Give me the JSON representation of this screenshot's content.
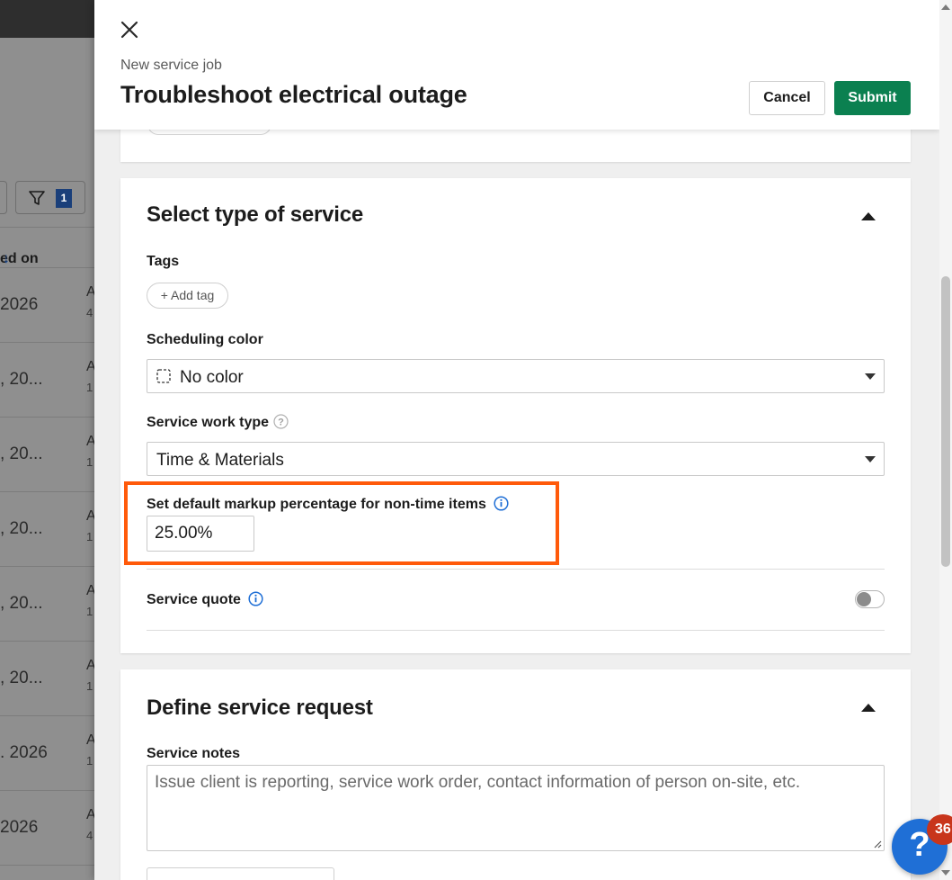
{
  "background": {
    "filter_count": "1",
    "column_header": "ed on",
    "rows": [
      {
        "date": "2026",
        "a": "A",
        "b": "4"
      },
      {
        "date": ", 20...",
        "a": "A",
        "b": "1"
      },
      {
        "date": ", 20...",
        "a": "A",
        "b": "1"
      },
      {
        "date": ", 20...",
        "a": "A",
        "b": "1"
      },
      {
        "date": ", 20...",
        "a": "A",
        "b": "1"
      },
      {
        "date": ", 20...",
        "a": "A",
        "b": "1"
      },
      {
        "date": ". 2026",
        "a": "A",
        "b": "1"
      },
      {
        "date": "2026",
        "a": "A",
        "b": "4"
      }
    ]
  },
  "header": {
    "subtitle": "New service job",
    "title": "Troubleshoot electrical outage",
    "cancel_label": "Cancel",
    "submit_label": "Submit"
  },
  "service_type": {
    "section_title": "Select type of service",
    "tags_label": "Tags",
    "add_tag_label": "+ Add tag",
    "scheduling_color_label": "Scheduling color",
    "scheduling_color_value": "No color",
    "work_type_label": "Service work type",
    "work_type_value": "Time & Materials",
    "markup_label": "Set default markup percentage for non-time items",
    "markup_value": "25.00%",
    "quote_label": "Service quote",
    "quote_enabled": false
  },
  "service_request": {
    "section_title": "Define service request",
    "notes_label": "Service notes",
    "notes_placeholder": "Issue client is reporting, service work order, contact information of person on-site, etc."
  },
  "help": {
    "symbol": "?",
    "badge_count": "36"
  },
  "colors": {
    "submit": "#0b8050",
    "highlight": "#ff5a0a",
    "info": "#1f6fd6",
    "badge": "#c8351b"
  }
}
